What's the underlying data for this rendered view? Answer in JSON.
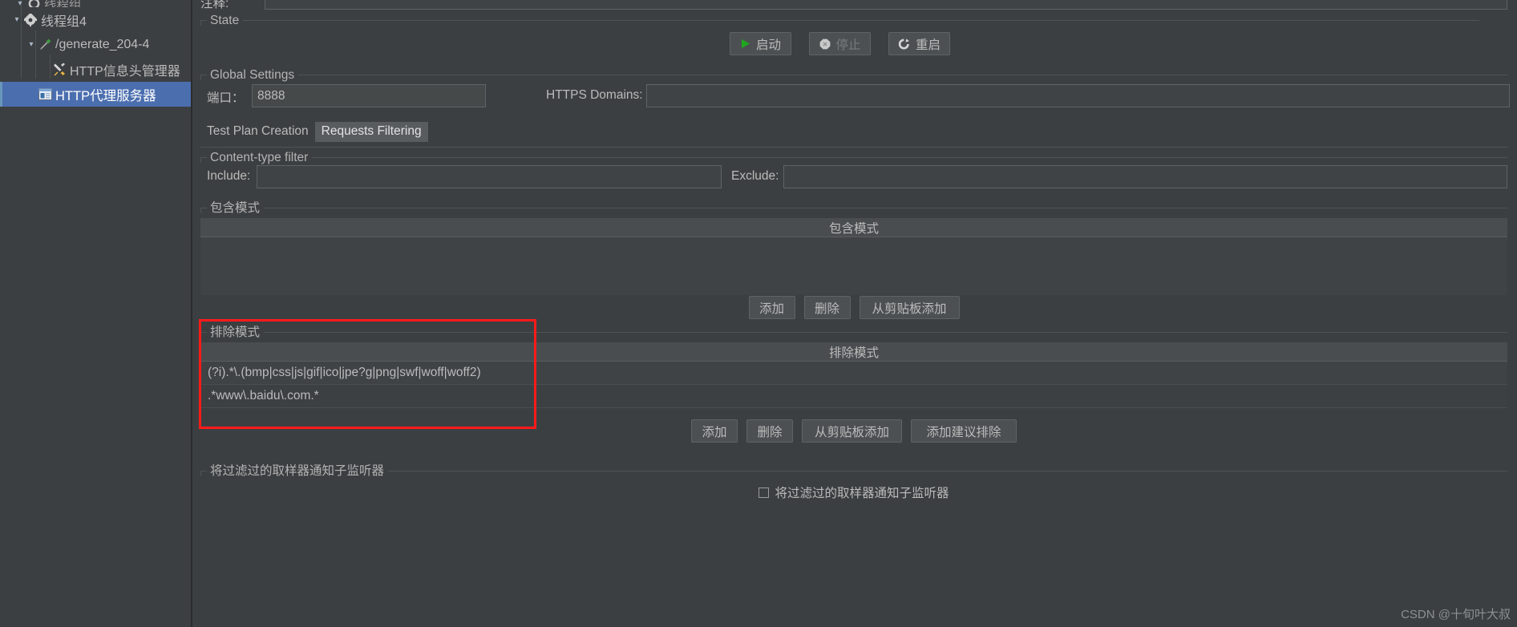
{
  "window": {
    "theme_bg": "#3c3f41",
    "accent_selection": "#4b6eaf",
    "highlight_box_color": "#ff1a1a"
  },
  "sidebar": {
    "items": [
      {
        "label": "线程组",
        "icon": "gear-icon",
        "depth": 1,
        "twisty": "chevron-down",
        "selected": false,
        "clipped": true
      },
      {
        "label": "线程组4",
        "icon": "gear-icon",
        "depth": 1,
        "twisty": "chevron-down",
        "selected": false,
        "clipped": false
      },
      {
        "label": "/generate_204-4",
        "icon": "pipette-icon",
        "depth": 2,
        "twisty": "chevron-down",
        "selected": false,
        "clipped": false
      },
      {
        "label": "HTTP信息头管理器",
        "icon": "tools-icon",
        "depth": 3,
        "twisty": "none",
        "selected": false,
        "clipped": false
      },
      {
        "label": "HTTP代理服务器",
        "icon": "window-icon",
        "depth": 2,
        "twisty": "none",
        "selected": true,
        "clipped": false
      }
    ]
  },
  "main": {
    "clipped_top_row": {
      "label": "注释:",
      "value": ""
    },
    "state_group": {
      "title": "State",
      "buttons": [
        {
          "label": "启动",
          "icon": "play-icon",
          "disabled": false
        },
        {
          "label": "停止",
          "icon": "stop-icon",
          "disabled": true
        },
        {
          "label": "重启",
          "icon": "restart-icon",
          "disabled": false
        }
      ]
    },
    "global_settings": {
      "title": "Global Settings",
      "port_label": "端口：",
      "port_value": "8888",
      "https_domains_label": "HTTPS Domains:",
      "https_domains_value": ""
    },
    "tabs": [
      {
        "label": "Test Plan Creation",
        "active": false
      },
      {
        "label": "Requests Filtering",
        "active": true
      }
    ],
    "content_type_filter": {
      "title": "Content-type filter",
      "include_label": "Include:",
      "include_value": "",
      "exclude_label": "Exclude:",
      "exclude_value": ""
    },
    "include_patterns": {
      "title": "包含模式",
      "column_header": "包含模式",
      "rows": [],
      "buttons": [
        "添加",
        "删除",
        "从剪贴板添加"
      ]
    },
    "exclude_patterns": {
      "title": "排除模式",
      "column_header": "排除模式",
      "rows": [
        "(?i).*\\.(bmp|css|js|gif|ico|jpe?g|png|swf|woff|woff2)",
        ".*www\\.baidu\\.com.*"
      ],
      "buttons": [
        "添加",
        "删除",
        "从剪贴板添加",
        "添加建议排除"
      ]
    },
    "notify_group": {
      "title": "将过滤过的取样器通知子监听器",
      "checkbox_label": "将过滤过的取样器通知子监听器",
      "checked": false
    }
  },
  "watermark": "CSDN @十旬叶大叔"
}
